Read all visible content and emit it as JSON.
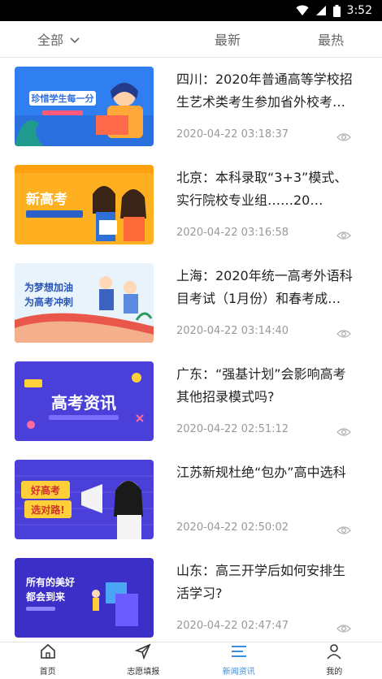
{
  "status": {
    "time": "3:52"
  },
  "tabs": {
    "all": "全部",
    "newest": "最新",
    "hot": "最热"
  },
  "news": [
    {
      "title": "四川：2020年普通高等学校招生艺术类考生参加省外校考…",
      "time": "2020-04-22 03:18:37",
      "thumb_text": "珍惜学生每一分"
    },
    {
      "title": "北京：本科录取“3+3”模式、实行院校专业组……20…",
      "time": "2020-04-22 03:16:58",
      "thumb_text": "新高考"
    },
    {
      "title": "上海：2020年统一高考外语科目考试（1月份）和春考成…",
      "time": "2020-04-22 03:14:40",
      "thumb_text": "为梦想加油 为高考冲刺"
    },
    {
      "title": "广东：“强基计划”会影响高考其他招录模式吗?",
      "time": "2020-04-22 02:51:12",
      "thumb_text": "高考资讯"
    },
    {
      "title": "江苏新规杜绝“包办”高中选科",
      "time": "2020-04-22 02:50:02",
      "thumb_text": "好高考 选对路!"
    },
    {
      "title": "山东：高三开学后如何安排生活学习?",
      "time": "2020-04-22 02:47:47",
      "thumb_text": "所有的美好 都会到来"
    }
  ],
  "nav": {
    "home": "首页",
    "volunteer": "志愿填报",
    "news": "新闻资讯",
    "mine": "我的"
  },
  "colors": {
    "accent": "#3b8de0"
  }
}
